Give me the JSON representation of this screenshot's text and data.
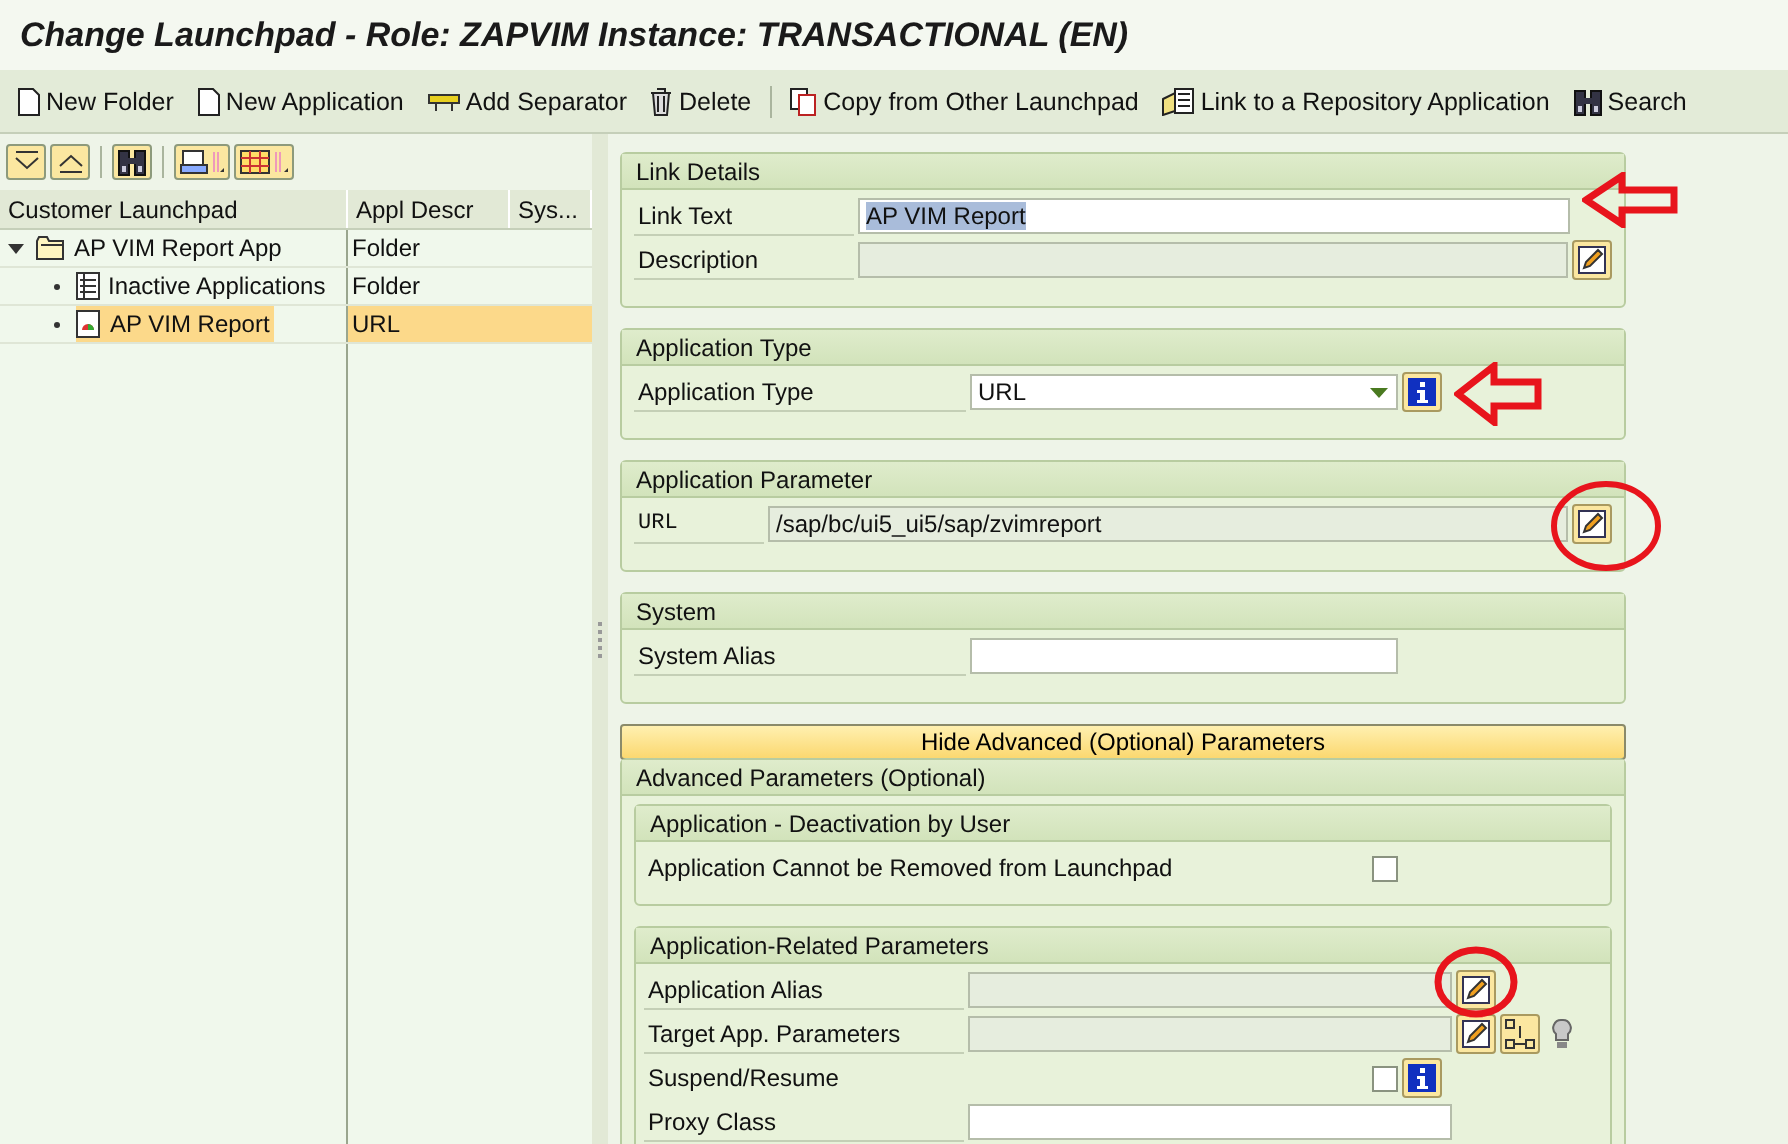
{
  "window": {
    "title": "Change Launchpad - Role: ZAPVIM Instance: TRANSACTIONAL (EN)"
  },
  "toolbar": [
    {
      "label": "New Folder"
    },
    {
      "label": "New Application"
    },
    {
      "label": "Add Separator"
    },
    {
      "label": "Delete"
    },
    {
      "label": "Copy from Other Launchpad"
    },
    {
      "label": "Link to a Repository Application"
    },
    {
      "label": "Search"
    }
  ],
  "tree": {
    "columns": [
      "Customer Launchpad",
      "Appl Descr",
      "Sys..."
    ],
    "rows": [
      {
        "label": "AP VIM Report App",
        "appl_descr": "Folder",
        "kind": "folder",
        "expanded": true,
        "selected": false,
        "children": [
          {
            "label": "Inactive Applications",
            "appl_descr": "Folder",
            "kind": "list",
            "selected": false
          },
          {
            "label": "AP VIM Report",
            "appl_descr": "URL",
            "kind": "application",
            "selected": true
          }
        ]
      }
    ]
  },
  "sections": [
    {
      "title": "Link Details",
      "rows": [
        {
          "kind": "input",
          "label": "Link Text",
          "value": "AP VIM Report",
          "editable": true,
          "value_selected": true,
          "actions": []
        },
        {
          "kind": "input",
          "label": "Description",
          "editable": false,
          "actions": [
            {
              "kind": "edit"
            }
          ]
        }
      ]
    },
    {
      "title": "Application Type",
      "rows": [
        {
          "kind": "dropdown",
          "label": "Application Type",
          "value": "URL",
          "editable": true,
          "actions": [
            {
              "kind": "info"
            }
          ]
        }
      ]
    },
    {
      "title": "Application Parameter",
      "rows": [
        {
          "kind": "input",
          "label": "URL",
          "value": "/sap/bc/ui5_ui5/sap/zvimreport",
          "editable": false,
          "actions": [
            {
              "kind": "edit"
            }
          ]
        }
      ]
    },
    {
      "title": "System",
      "rows": [
        {
          "kind": "input",
          "label": "System Alias",
          "editable": true,
          "actions": []
        }
      ]
    }
  ],
  "toggle_button": "Hide Advanced (Optional) Parameters",
  "advanced": {
    "title": "Advanced Parameters (Optional)",
    "groups": [
      {
        "title": "Application - Deactivation by User",
        "rows": [
          {
            "kind": "checkbox",
            "label": "Application Cannot be Removed from Launchpad",
            "checked": false,
            "actions": []
          }
        ]
      },
      {
        "title": "Application-Related Parameters",
        "rows": [
          {
            "kind": "input",
            "label": "Application Alias",
            "editable": false,
            "actions": [
              {
                "kind": "edit"
              }
            ]
          },
          {
            "kind": "input",
            "label": "Target App. Parameters",
            "editable": false,
            "actions": [
              {
                "kind": "edit"
              },
              {
                "kind": "mapping"
              },
              {
                "kind": "bulb"
              }
            ]
          },
          {
            "kind": "checkbox",
            "label": "Suspend/Resume",
            "checked": false,
            "actions": [
              {
                "kind": "info"
              }
            ]
          },
          {
            "kind": "input",
            "label": "Proxy Class",
            "editable": true,
            "actions": []
          }
        ]
      }
    ]
  }
}
